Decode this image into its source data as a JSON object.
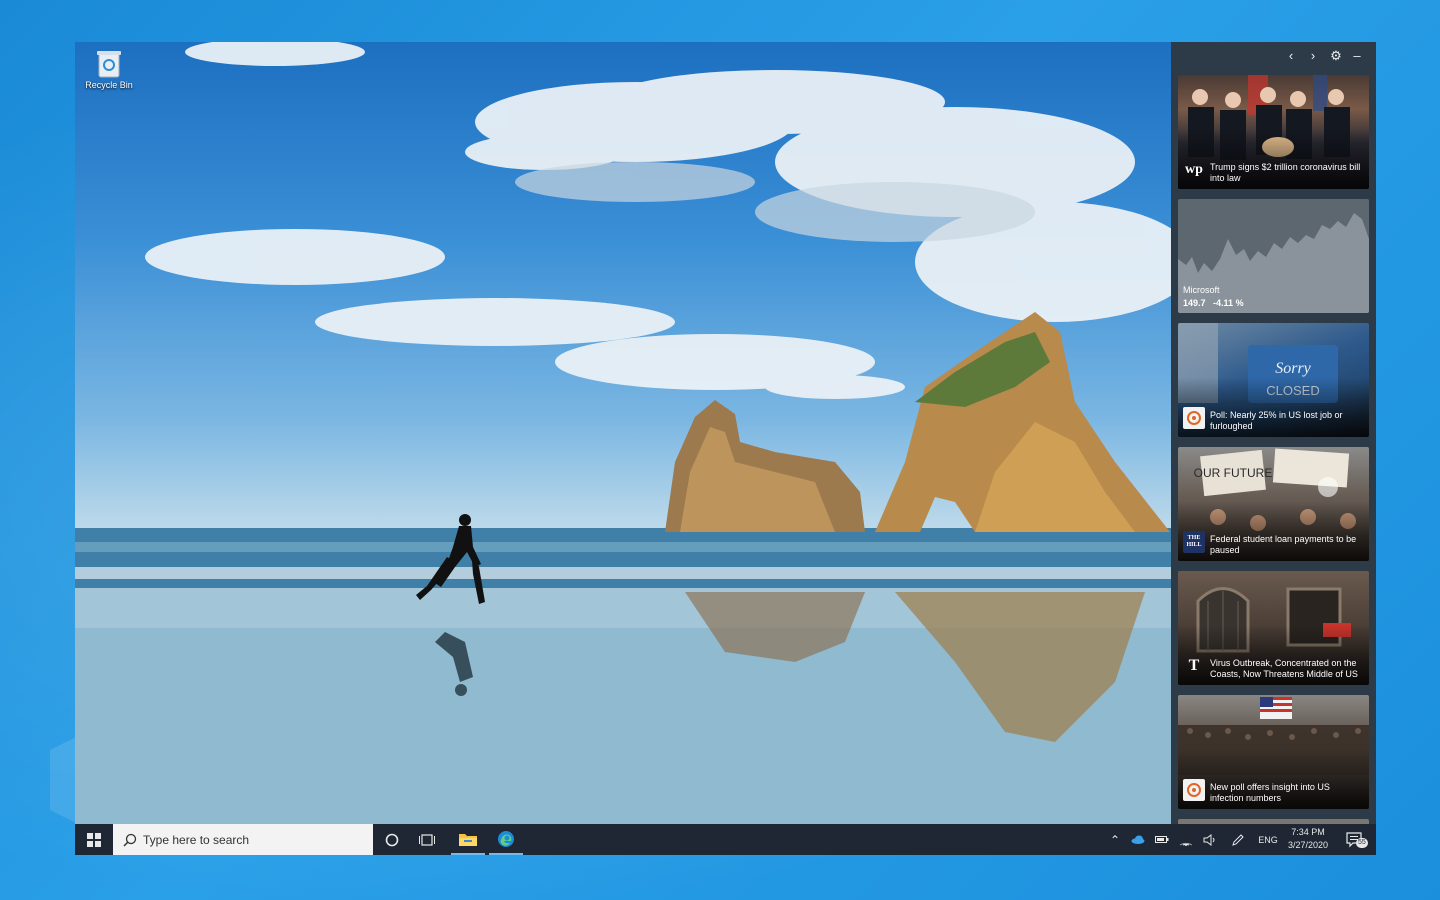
{
  "desktop": {
    "icons": [
      {
        "label": "Recycle Bin",
        "icon": "recycle-bin-icon"
      }
    ]
  },
  "news_panel": {
    "header_icons": [
      "chevron-left-icon",
      "chevron-right-icon",
      "gear-icon",
      "minimize-icon"
    ],
    "cards": [
      {
        "type": "news",
        "headline": "Trump signs $2 trillion coronavirus bill into law",
        "source_logo": "wp",
        "source_icon": "washington-post-logo"
      },
      {
        "type": "stock",
        "name": "Microsoft",
        "price": "149.7",
        "change": "-4.11 %"
      },
      {
        "type": "news",
        "headline": "Poll: Nearly 25% in US lost job or furloughed",
        "source_icon": "news-source-logo"
      },
      {
        "type": "news",
        "headline": "Federal student loan payments to be paused",
        "source_logo": "THE HILL",
        "source_icon": "the-hill-logo"
      },
      {
        "type": "news",
        "headline": "Virus Outbreak, Concentrated on the Coasts, Now Threatens Middle of US",
        "source_logo": "T",
        "source_icon": "nyt-logo"
      },
      {
        "type": "news",
        "headline": "New poll offers insight into US infection numbers",
        "source_icon": "news-source-logo"
      }
    ]
  },
  "taskbar": {
    "search_placeholder": "Type here to search",
    "apps": [
      "start-icon",
      "cortana-icon",
      "task-view-icon",
      "file-explorer-icon",
      "edge-icon"
    ],
    "tray": {
      "icons": [
        "chevron-up-icon",
        "onedrive-icon",
        "battery-icon",
        "wifi-icon",
        "volume-icon",
        "pen-icon"
      ],
      "language": "ENG",
      "time": "7:34 PM",
      "date": "3/27/2020",
      "notification_count": "55"
    }
  },
  "colors": {
    "taskbar": "#1e2733",
    "panel": "#2d3a48",
    "accent_blue": "#0078d7"
  }
}
